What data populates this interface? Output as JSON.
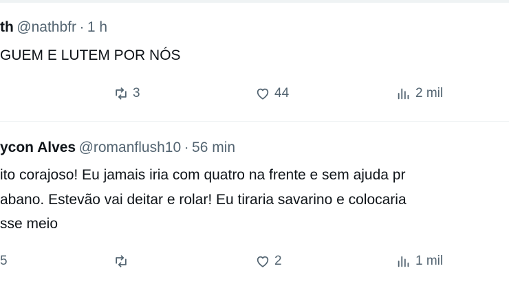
{
  "tweets": [
    {
      "name": "th",
      "handle": "@nathbfr",
      "sep": "·",
      "time": "1 h",
      "lines": [
        "GUEM E LUTEM POR NÓS"
      ],
      "actions": {
        "reply": "",
        "retweet": "3",
        "like": "44",
        "views": "2 mil"
      }
    },
    {
      "name": "ycon Alves",
      "handle": "@romanflush10",
      "sep": "·",
      "time": "56 min",
      "lines": [
        "ito corajoso! Eu jamais iria com quatro na frente e sem ajuda pr",
        "abano. Estevão vai deitar e rolar! Eu tiraria savarino e colocaria",
        "sse meio"
      ],
      "actions": {
        "reply": "5",
        "retweet": "",
        "like": "2",
        "views": "1 mil"
      }
    }
  ],
  "colors": {
    "text": "#0f1419",
    "secondary": "#536471",
    "divider": "#eff3f4"
  },
  "icons": [
    "reply-icon",
    "retweet-icon",
    "like-icon",
    "views-icon"
  ]
}
